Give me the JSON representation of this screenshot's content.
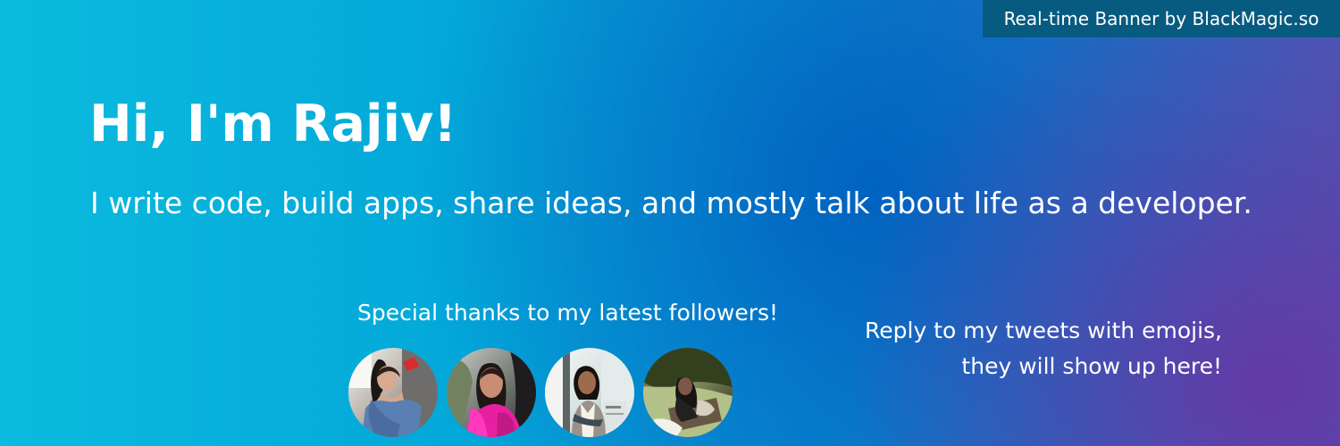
{
  "banner": {
    "attribution": "Real-time Banner by BlackMagic.so",
    "title": "Hi, I'm Rajiv!",
    "tagline": "I write code, build apps, share ideas, and mostly talk about life as a developer.",
    "followers": {
      "heading": "Special thanks to my latest followers!",
      "avatars": [
        {
          "icon": "follower-avatar-icon-1"
        },
        {
          "icon": "follower-avatar-icon-2"
        },
        {
          "icon": "follower-avatar-icon-3"
        },
        {
          "icon": "follower-avatar-icon-4"
        }
      ]
    },
    "reply_note": {
      "line_1": "Reply to my tweets with emojis,",
      "line_2": "they will show up here!"
    }
  }
}
